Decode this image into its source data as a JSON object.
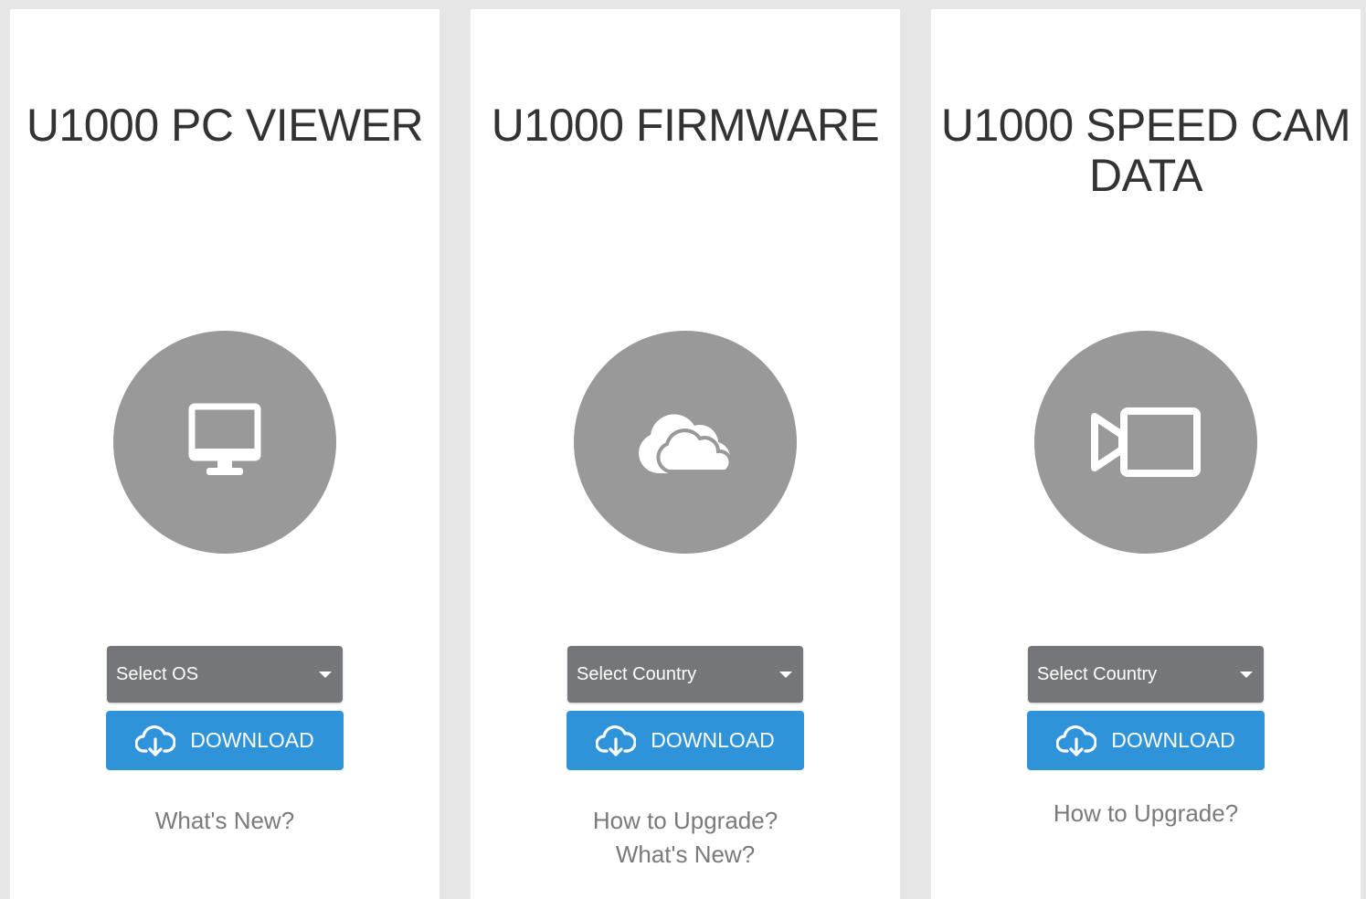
{
  "cards": [
    {
      "title": "U1000 PC VIEWER",
      "icon": "monitor-icon",
      "select_label": "Select OS",
      "download_label": "DOWNLOAD",
      "links": [
        "What's New?"
      ]
    },
    {
      "title": "U1000 FIRMWARE",
      "icon": "cloud-icon",
      "select_label": "Select Country",
      "download_label": "DOWNLOAD",
      "links": [
        "How to Upgrade?",
        "What's New?"
      ]
    },
    {
      "title": "U1000 SPEED CAM DATA",
      "icon": "video-camera-icon",
      "select_label": "Select Country",
      "download_label": "DOWNLOAD",
      "links": [
        "How to Upgrade?"
      ]
    }
  ],
  "colors": {
    "page_background": "#e6e6e6",
    "card_background": "#ffffff",
    "icon_circle": "#999999",
    "select_background": "#75767a",
    "download_button": "#2e93d8",
    "link_text": "#7a7a7a",
    "title_text": "#333333"
  }
}
